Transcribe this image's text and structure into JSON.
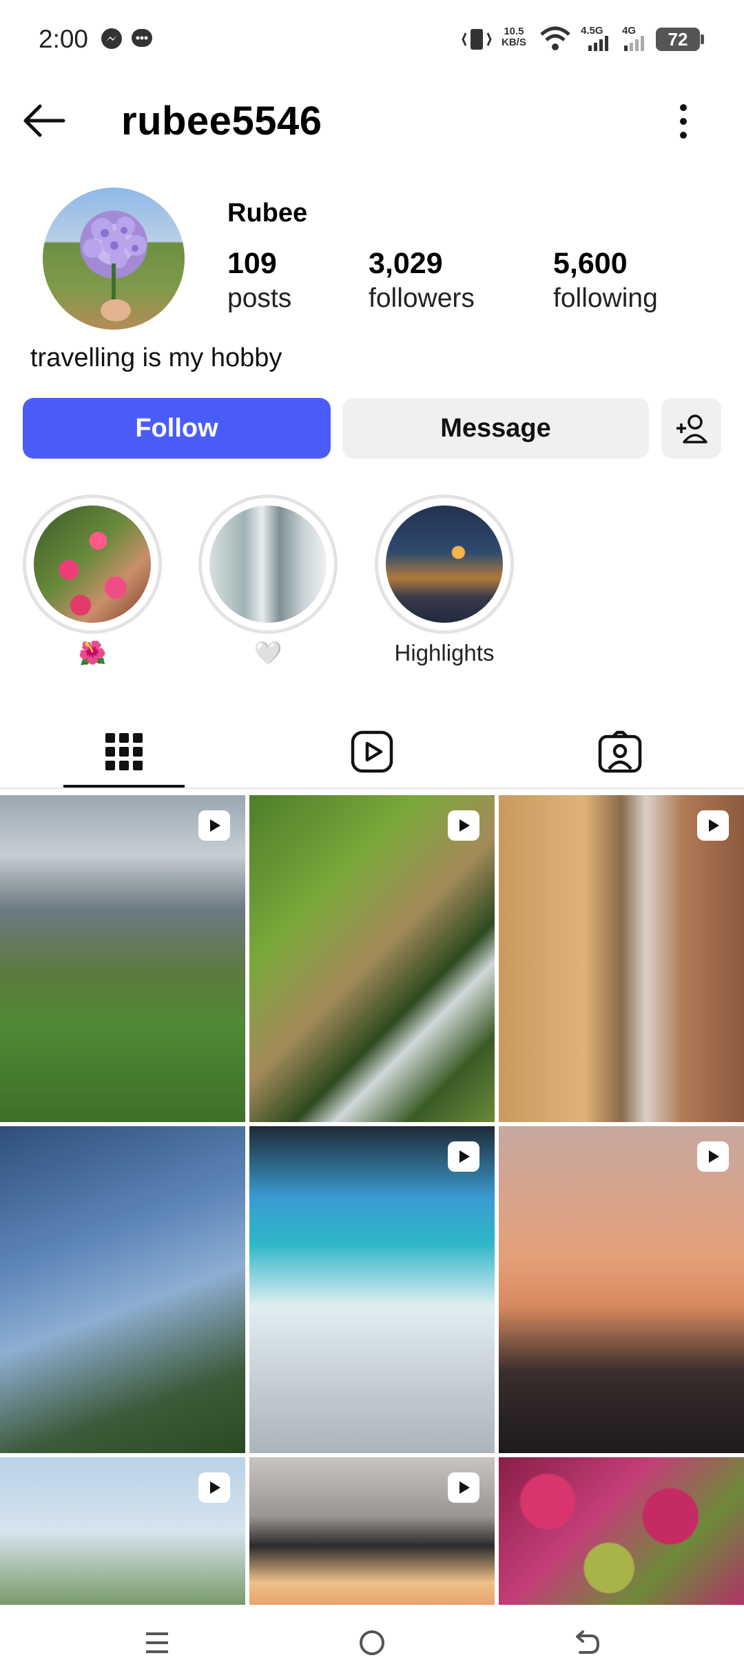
{
  "status_bar": {
    "time": "2:00",
    "net_speed_value": "10.5",
    "net_speed_unit": "KB/S",
    "signal1_label": "4.5G",
    "signal2_label": "4G",
    "battery": "72",
    "icons": [
      "messenger-icon",
      "chat-bubble-icon",
      "vibrate-icon",
      "wifi-icon",
      "signal-icon",
      "battery-icon"
    ]
  },
  "header": {
    "username": "rubee5546"
  },
  "profile": {
    "display_name": "Rubee",
    "stats": [
      {
        "value": "109",
        "label": "posts"
      },
      {
        "value": "3,029",
        "label": "followers"
      },
      {
        "value": "5,600",
        "label": "following"
      }
    ],
    "bio": "travelling is my hobby"
  },
  "actions": {
    "follow_label": "Follow",
    "message_label": "Message",
    "accent_color": "#4a5df9"
  },
  "highlights": [
    {
      "label": "🌺"
    },
    {
      "label": "🤍"
    },
    {
      "label": "Highlights"
    }
  ],
  "tabs": [
    "grid-icon",
    "reels-icon",
    "tagged-icon"
  ],
  "grid": [
    {
      "reel": true,
      "scene": "alpine valley"
    },
    {
      "reel": true,
      "scene": "waterfall"
    },
    {
      "reel": true,
      "scene": "city street"
    },
    {
      "reel": false,
      "scene": "glass tower"
    },
    {
      "reel": true,
      "scene": "beach lounge"
    },
    {
      "reel": true,
      "scene": "sunset glass"
    },
    {
      "reel": true,
      "scene": "palm skyline"
    },
    {
      "reel": true,
      "scene": "sunset ceiling"
    },
    {
      "reel": false,
      "scene": "flower arch"
    }
  ]
}
